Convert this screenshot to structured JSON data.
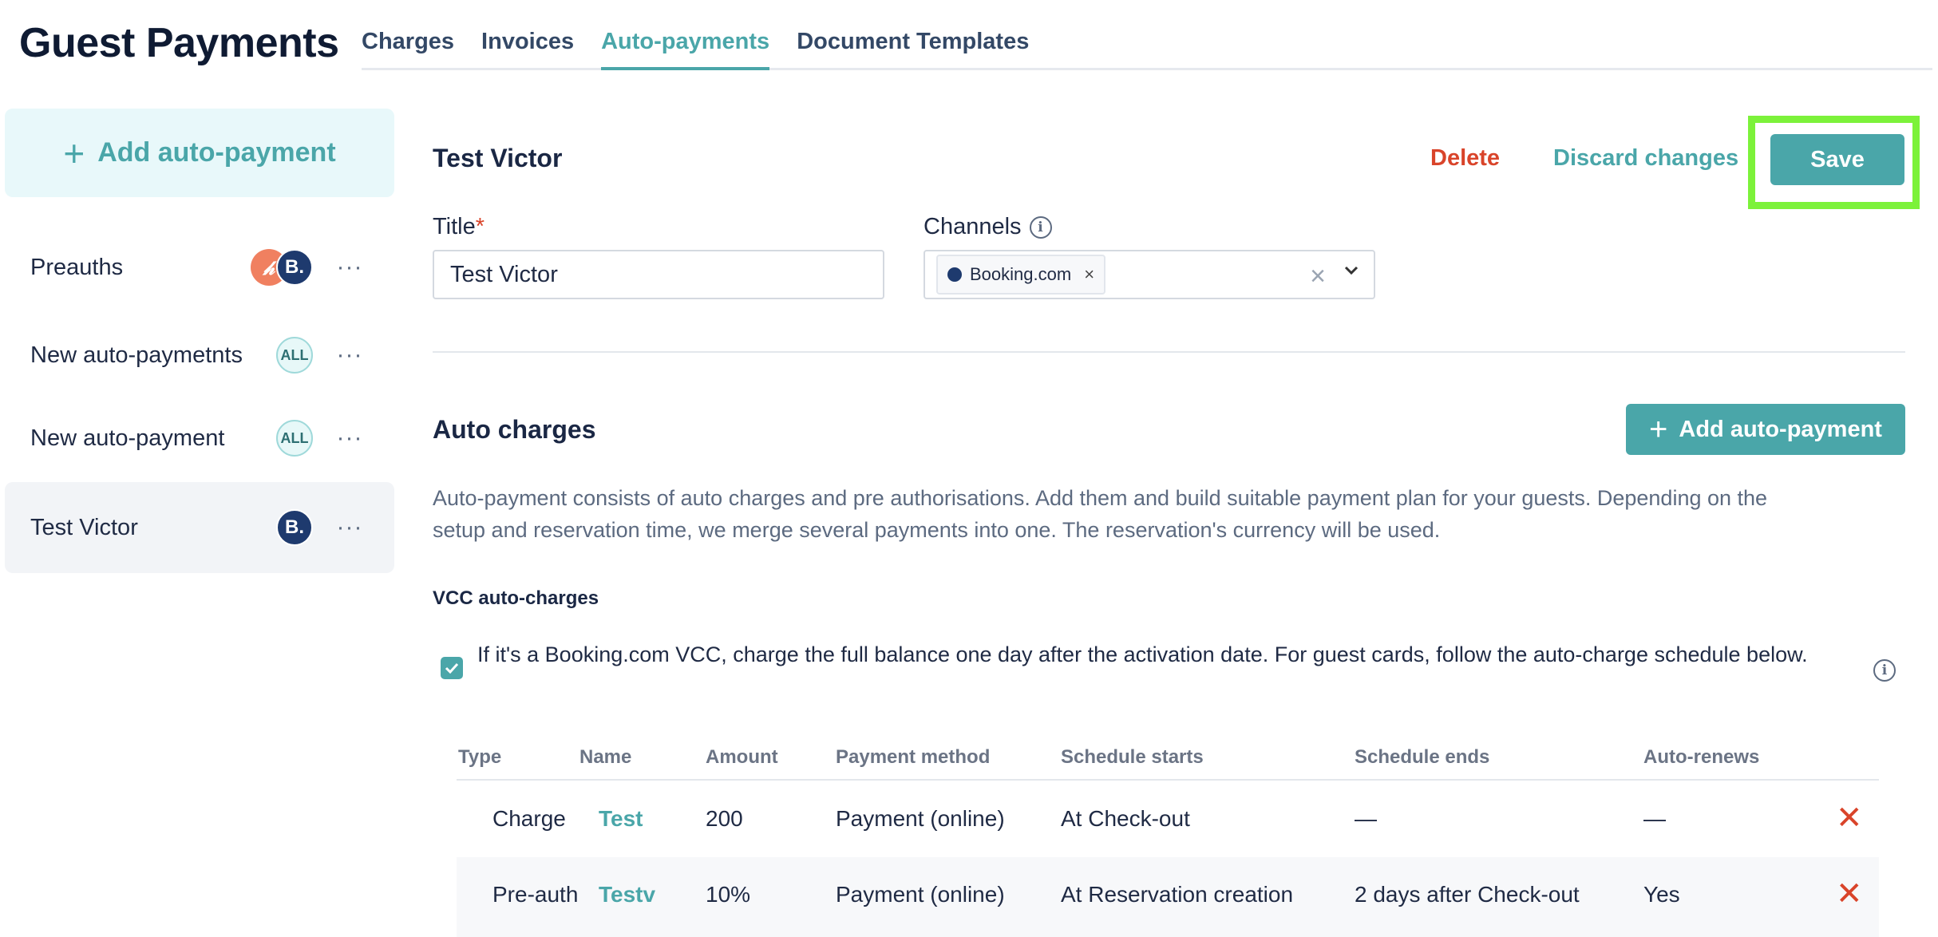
{
  "header": {
    "title": "Guest Payments",
    "tabs": [
      {
        "label": "Charges",
        "active": false
      },
      {
        "label": "Invoices",
        "active": false
      },
      {
        "label": "Auto-payments",
        "active": true
      },
      {
        "label": "Document Templates",
        "active": false
      }
    ]
  },
  "sidebar": {
    "add_label": "Add auto-payment",
    "items": [
      {
        "label": "Preauths",
        "badges": [
          "hostaway",
          "B."
        ],
        "menu": "···"
      },
      {
        "label": "New auto-paymetnts",
        "badges": [
          "ALL"
        ],
        "menu": "···"
      },
      {
        "label": "New auto-payment",
        "badges": [
          "ALL"
        ],
        "menu": "···"
      },
      {
        "label": "Test Victor",
        "badges": [
          "B."
        ],
        "menu": "···",
        "selected": true
      }
    ],
    "hostaway_glyph": "𝒽"
  },
  "main": {
    "title": "Test Victor",
    "delete_label": "Delete",
    "discard_label": "Discard changes",
    "save_label": "Save",
    "title_field": {
      "label": "Title",
      "required_mark": "*",
      "value": "Test Victor"
    },
    "channels_field": {
      "label": "Channels",
      "info": "i",
      "chip": "Booking.com",
      "chip_remove": "×",
      "clear": "×"
    },
    "auto_charges": {
      "title": "Auto charges",
      "add_label": "Add auto-payment",
      "description": "Auto-payment consists of auto charges and pre authorisations. Add them and build suitable payment plan for your guests. Depending on the setup and reservation time, we merge several payments into one. The reservation's currency will be used.",
      "vcc_title": "VCC auto-charges",
      "vcc_checkbox_checked": true,
      "vcc_text": "If it's a Booking.com VCC, charge the full balance one day after the activation date. For guest cards, follow the auto-charge schedule below.",
      "info": "i"
    },
    "table": {
      "columns": [
        "Type",
        "Name",
        "Amount",
        "Payment method",
        "Schedule starts",
        "Schedule ends",
        "Auto-renews"
      ],
      "rows": [
        {
          "type": "Charge",
          "name": "Test",
          "amount": "200",
          "method": "Payment (online)",
          "starts": "At Check-out",
          "ends": "—",
          "renews": "—",
          "remove": "✕"
        },
        {
          "type": "Pre-auth",
          "name": "Testv",
          "amount": "10%",
          "method": "Payment (online)",
          "starts": "At Reservation creation",
          "ends": "2 days after Check-out",
          "renews": "Yes",
          "remove": "✕"
        }
      ]
    }
  },
  "colors": {
    "accent": "#4aa6a9",
    "danger": "#d9442a",
    "highlight": "#7cf23a",
    "booking": "#1e3a6e"
  },
  "icons": [
    "plus-icon",
    "more-dots-icon",
    "info-icon",
    "close-icon",
    "chevron-down-icon",
    "check-icon",
    "delete-x-icon"
  ]
}
